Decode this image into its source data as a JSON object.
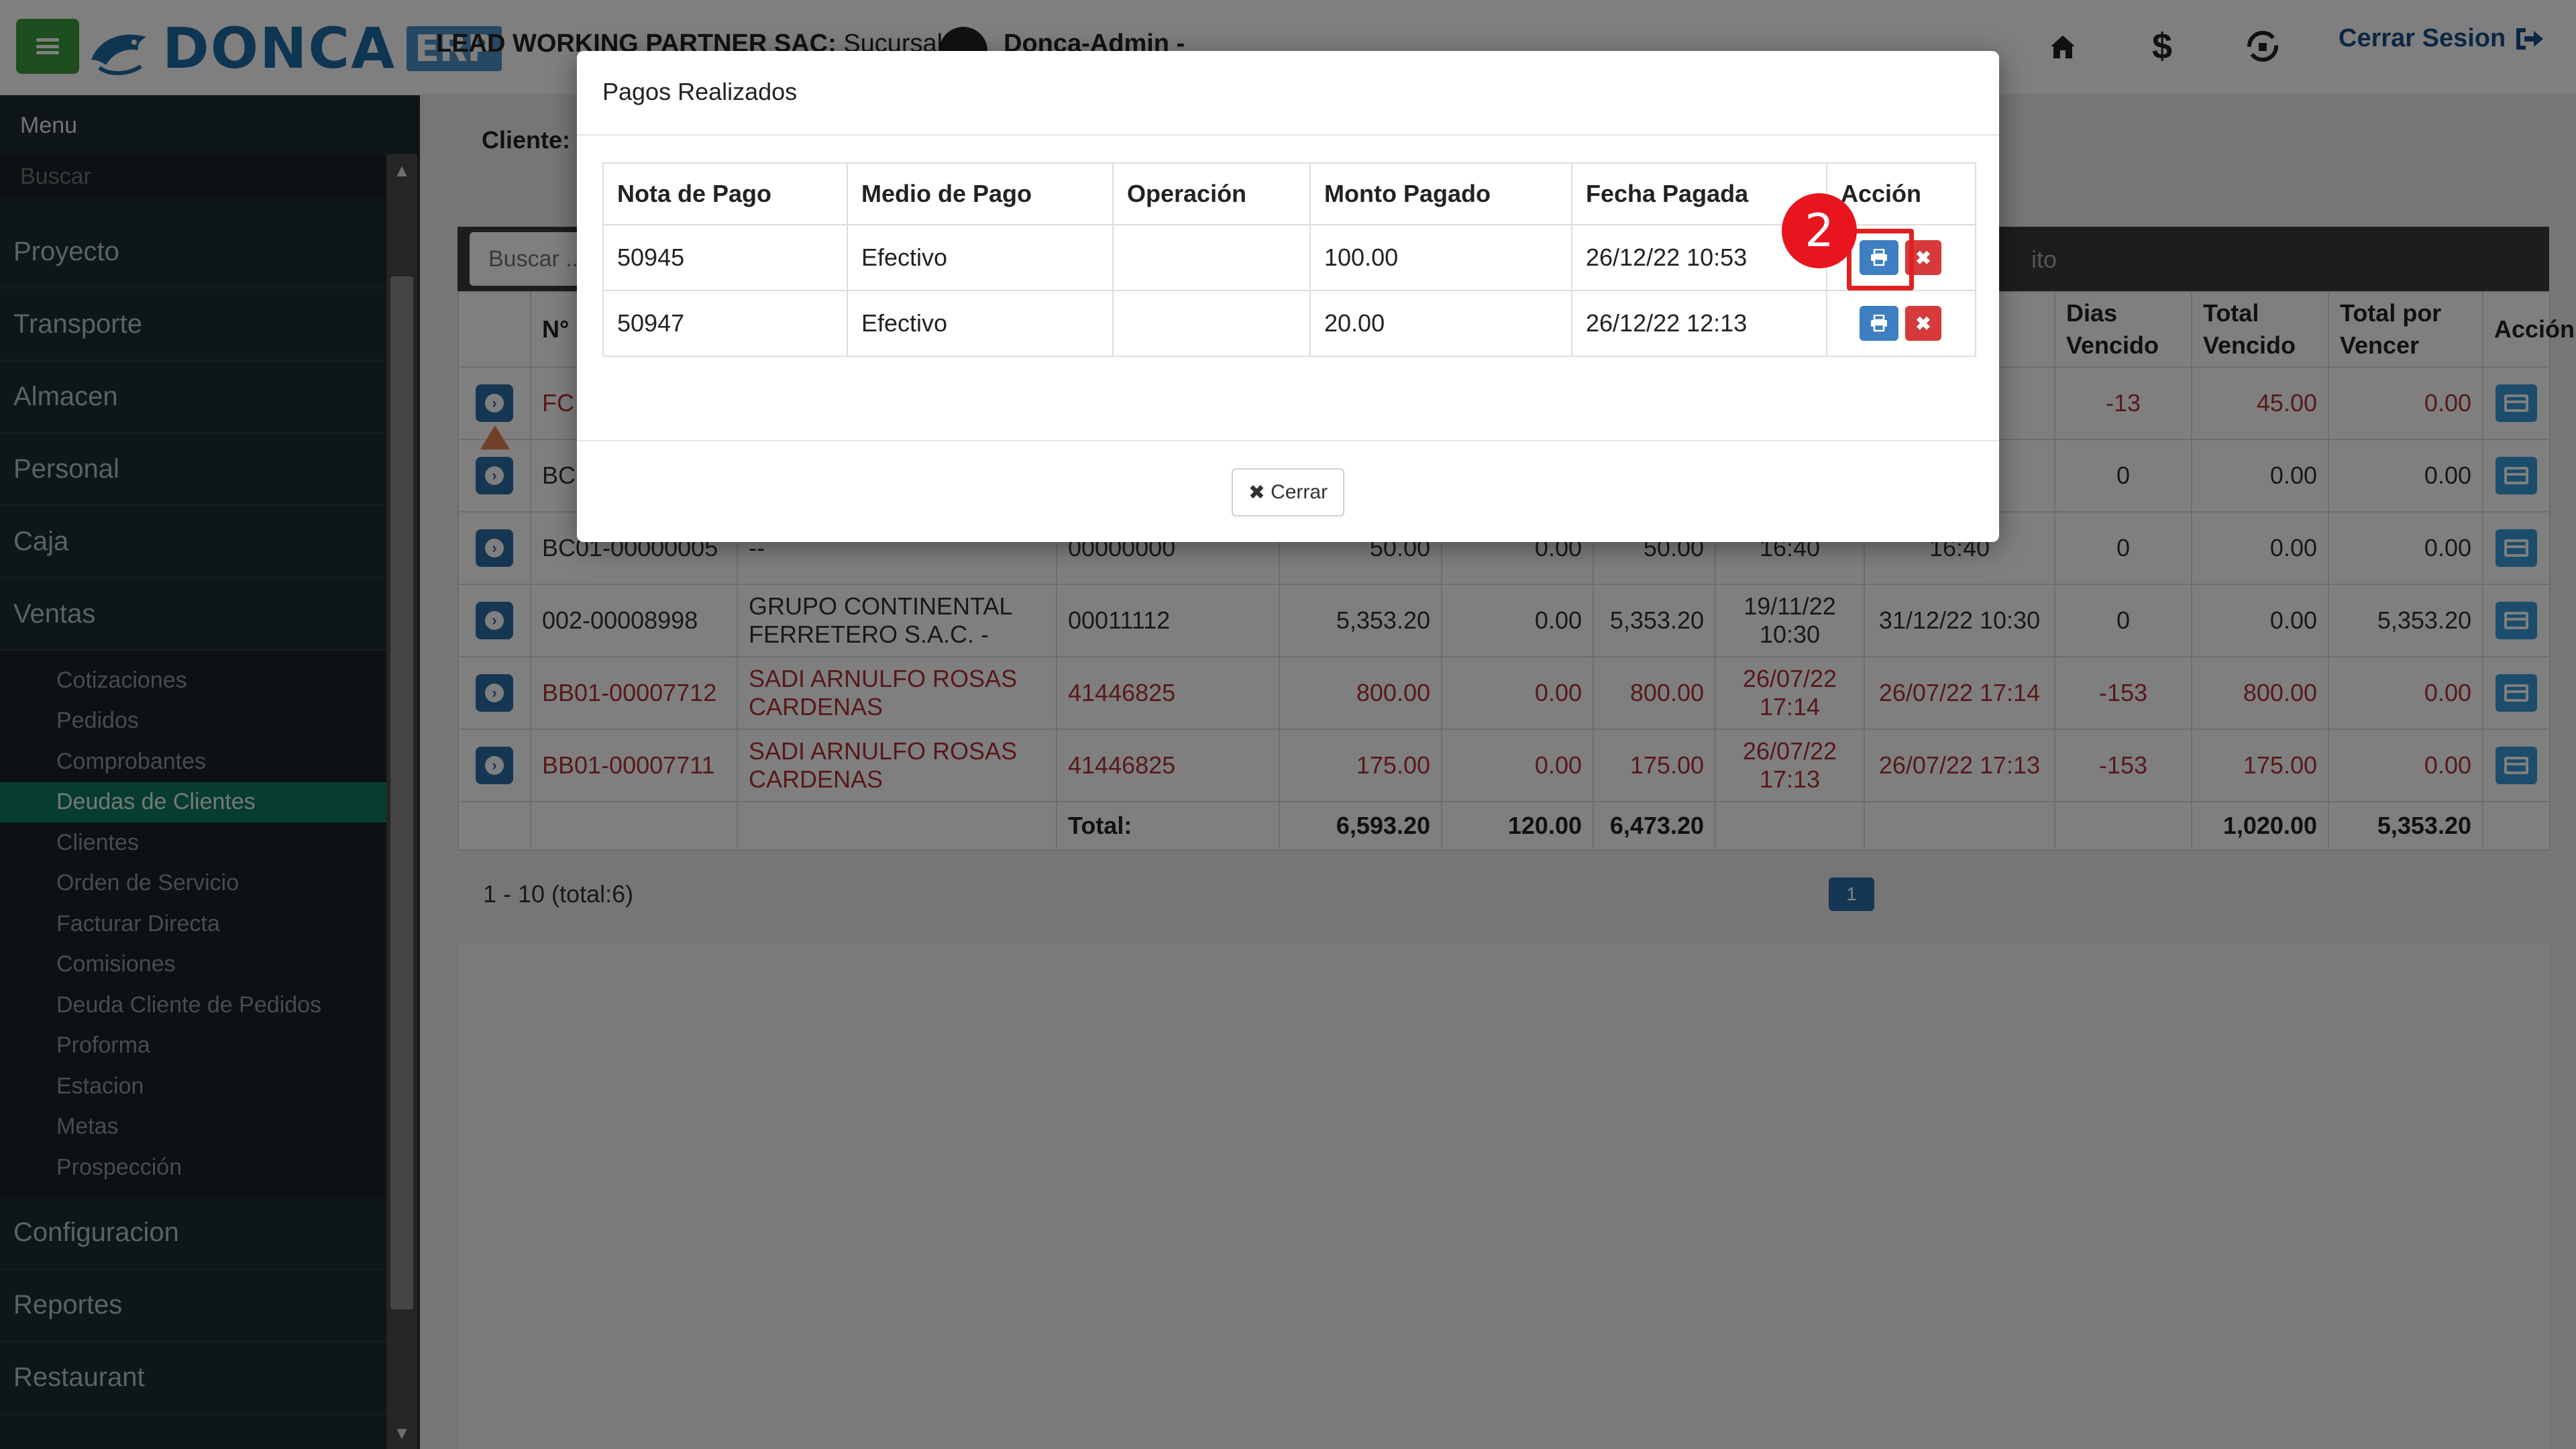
{
  "header": {
    "logo_text": "DONCA",
    "logo_badge": "ERP",
    "company": "LEAD WORKING PARTNER SAC:",
    "branch": "Sucursal k |",
    "user": "Donca-Admin -",
    "logout_label": "Cerrar Sesion",
    "icons": [
      "home-icon",
      "dollar-icon",
      "sync-icon",
      "logout-icon"
    ]
  },
  "sidebar": {
    "title": "Menu",
    "search_placeholder": "Buscar",
    "items": [
      "Proyecto",
      "Transporte",
      "Almacen",
      "Personal",
      "Caja",
      "Ventas"
    ],
    "ventas_sub": [
      "Cotizaciones",
      "Pedidos",
      "Comprobantes",
      "Deudas de Clientes",
      "Clientes",
      "Orden de Servicio",
      "Facturar Directa",
      "Comisiones",
      "Deuda Cliente de Pedidos",
      "Proforma",
      "Estacion",
      "Metas",
      "Prospección"
    ],
    "active_sub": "Deudas de Clientes",
    "items_after": [
      "Configuracion",
      "Reportes",
      "Restaurant"
    ]
  },
  "main": {
    "cliente_label": "Cliente:",
    "search_placeholder": "Buscar ...",
    "toolbar_text": "ito",
    "columns": {
      "n": "N°",
      "dias_vencido": "Dias Vencido",
      "total_vencido": "Total Vencido",
      "total_por_vencer": "Total por Vencer",
      "accion": "Acción"
    },
    "rows": [
      {
        "doc": "FC",
        "cliente": "",
        "ruc": "",
        "monto": "",
        "pagado": "",
        "saldo": "",
        "f1": "",
        "f2": "",
        "dias": "-13",
        "vencido": "45.00",
        "por_vencer": "0.00",
        "red": true
      },
      {
        "doc": "BC",
        "cliente": "",
        "ruc": "",
        "monto": "",
        "pagado": "",
        "saldo": "",
        "f1": "",
        "f2": "",
        "dias": "0",
        "vencido": "0.00",
        "por_vencer": "0.00",
        "red": false
      },
      {
        "doc": "BC01-00000005",
        "cliente": "--",
        "ruc": "00000000",
        "monto": "50.00",
        "pagado": "0.00",
        "saldo": "50.00",
        "f1": "16:40",
        "f2": "16:40",
        "dias": "0",
        "vencido": "0.00",
        "por_vencer": "0.00",
        "red": false
      },
      {
        "doc": "002-00008998",
        "cliente": "GRUPO CONTINENTAL FERRETERO S.A.C. -",
        "ruc": "00011112",
        "monto": "5,353.20",
        "pagado": "0.00",
        "saldo": "5,353.20",
        "f1": "19/11/22 10:30",
        "f2": "31/12/22 10:30",
        "dias": "0",
        "vencido": "0.00",
        "por_vencer": "5,353.20",
        "red": false
      },
      {
        "doc": "BB01-00007712",
        "cliente": "SADI ARNULFO ROSAS CARDENAS",
        "ruc": "41446825",
        "monto": "800.00",
        "pagado": "0.00",
        "saldo": "800.00",
        "f1": "26/07/22 17:14",
        "f2": "26/07/22 17:14",
        "dias": "-153",
        "vencido": "800.00",
        "por_vencer": "0.00",
        "red": true
      },
      {
        "doc": "BB01-00007711",
        "cliente": "SADI ARNULFO ROSAS CARDENAS",
        "ruc": "41446825",
        "monto": "175.00",
        "pagado": "0.00",
        "saldo": "175.00",
        "f1": "26/07/22 17:13",
        "f2": "26/07/22 17:13",
        "dias": "-153",
        "vencido": "175.00",
        "por_vencer": "0.00",
        "red": true
      }
    ],
    "totals": {
      "label": "Total:",
      "monto": "6,593.20",
      "pagado": "120.00",
      "saldo": "6,473.20",
      "vencido": "1,020.00",
      "por_vencer": "5,353.20"
    },
    "pager_info": "1 - 10 (total:6)",
    "current_page": "1"
  },
  "modal": {
    "title": "Pagos Realizados",
    "columns": [
      "Nota de Pago",
      "Medio de Pago",
      "Operación",
      "Monto Pagado",
      "Fecha Pagada",
      "Acción"
    ],
    "rows": [
      {
        "nota": "50945",
        "medio": "Efectivo",
        "operacion": "",
        "monto": "100.00",
        "fecha": "26/12/22 10:53"
      },
      {
        "nota": "50947",
        "medio": "Efectivo",
        "operacion": "",
        "monto": "20.00",
        "fecha": "26/12/22 12:13"
      }
    ],
    "close_label": "Cerrar",
    "step_badge": "2",
    "accent_red": "#e8141e",
    "print_blue": "#3d7fc1",
    "delete_red": "#d63a3a"
  }
}
